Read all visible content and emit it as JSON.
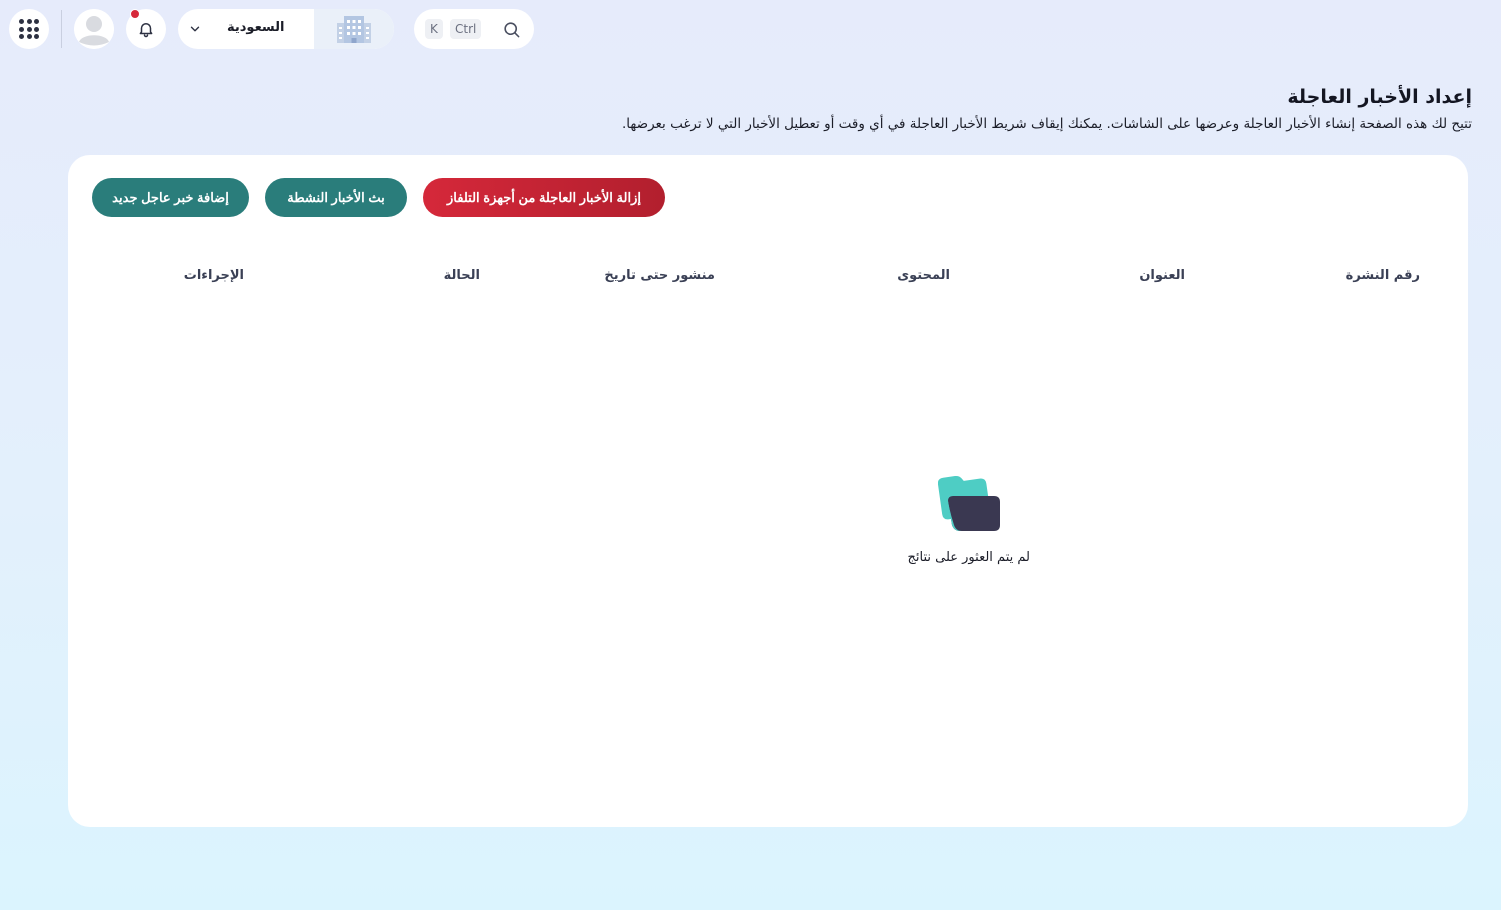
{
  "topbar": {
    "country": "السعودية",
    "shortcut_key": "K",
    "shortcut_modifier": "Ctrl",
    "icons": {
      "apps": "apps-grid-icon",
      "avatar": "user-avatar-icon",
      "bell": "bell-icon",
      "chevron": "chevron-down-icon",
      "building": "building-icon",
      "search": "search-icon"
    },
    "notification_color": "#d6283a"
  },
  "header": {
    "title": "إعداد الأخبار العاجلة",
    "description": "تتيح لك هذه الصفحة إنشاء الأخبار العاجلة وعرضها على الشاشات. يمكنك إيقاف شريط الأخبار العاجلة في أي وقت أو تعطيل الأخبار التي لا ترغب بعرضها."
  },
  "actions": {
    "add_label": "إضافة خبر عاجل جديد",
    "broadcast_label": "بث الأخبار النشطة",
    "remove_label": "إزالة الأخبار العاجلة من أجهزة التلفاز"
  },
  "table": {
    "columns": [
      "رقم النشرة",
      "العنوان",
      "المحتوى",
      "منشور حتى تاريخ",
      "الحالة",
      "الإجراءات"
    ],
    "rows": [],
    "empty_message": "لم يتم العثور على نتائج"
  },
  "colors": {
    "primary": "#2a7d7b",
    "danger": "#d5283a",
    "card": "#ffffff"
  }
}
